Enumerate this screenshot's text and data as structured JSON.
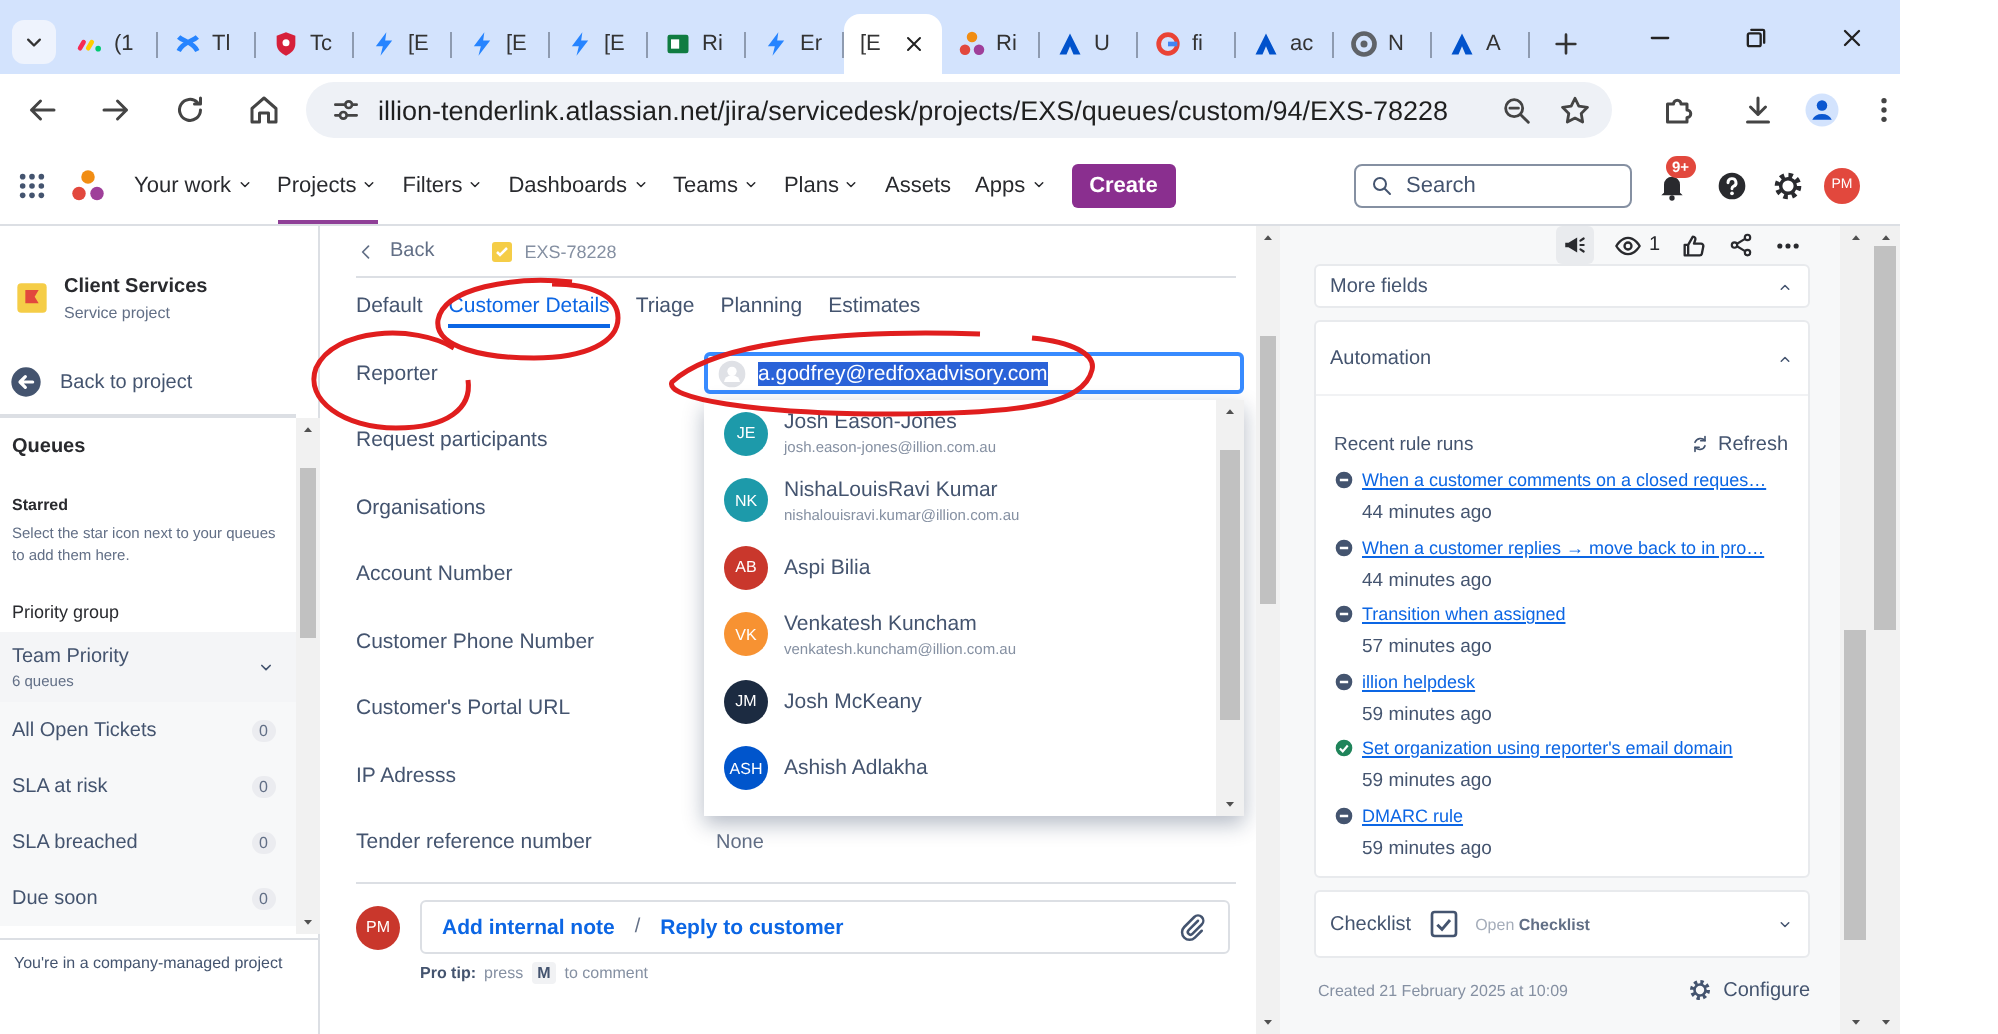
{
  "browser": {
    "tabs": [
      {
        "label": "(1",
        "kind": "bars",
        "selected": false
      },
      {
        "label": "Tl",
        "kind": "cross",
        "selected": false
      },
      {
        "label": "Tc",
        "kind": "shield",
        "selected": false
      },
      {
        "label": "[E",
        "kind": "bolt",
        "selected": false
      },
      {
        "label": "[E",
        "kind": "bolt",
        "selected": false
      },
      {
        "label": "[E",
        "kind": "bolt",
        "selected": false
      },
      {
        "label": "Ri",
        "kind": "sheet",
        "selected": false
      },
      {
        "label": "Er",
        "kind": "bolt",
        "selected": false
      },
      {
        "label": "[E",
        "selected": true
      },
      {
        "label": "Ri",
        "kind": "dots",
        "selected": false
      },
      {
        "label": "U",
        "kind": "peak",
        "selected": false
      },
      {
        "label": "fi",
        "kind": "ring",
        "selected": false
      },
      {
        "label": "ac",
        "kind": "peak",
        "selected": false
      },
      {
        "label": "N",
        "kind": "chrome",
        "selected": false
      },
      {
        "label": "A",
        "kind": "peak",
        "selected": false
      }
    ],
    "url": "illion-tenderlink.atlassian.net/jira/servicedesk/projects/EXS/queues/custom/94/EXS-78228"
  },
  "nav": {
    "items": [
      {
        "label": "Your work",
        "menu": true,
        "selected": false
      },
      {
        "label": "Projects",
        "menu": true,
        "selected": true
      },
      {
        "label": "Filters",
        "menu": true,
        "selected": false
      },
      {
        "label": "Dashboards",
        "menu": true,
        "selected": false
      },
      {
        "label": "Teams",
        "menu": true,
        "selected": false
      },
      {
        "label": "Plans",
        "menu": true,
        "selected": false
      },
      {
        "label": "Assets",
        "menu": false,
        "selected": false
      },
      {
        "label": "Apps",
        "menu": true,
        "selected": false
      }
    ],
    "create": "Create",
    "search": {
      "placeholder": "Search"
    },
    "notifications": "9+",
    "avatar": "PM"
  },
  "sidebar": {
    "project": {
      "name": "Client Services",
      "type": "Service project"
    },
    "back": "Back to project",
    "queues_heading": "Queues",
    "starred": {
      "heading": "Starred",
      "hint": "Select the star icon next to your queues to add them here."
    },
    "group": {
      "heading": "Priority group",
      "name": "Team Priority",
      "count": "6 queues"
    },
    "queues": [
      {
        "name": "All Open Tickets",
        "count": "0"
      },
      {
        "name": "SLA at risk",
        "count": "0"
      },
      {
        "name": "SLA breached",
        "count": "0"
      },
      {
        "name": "Due soon",
        "count": "0"
      }
    ],
    "footer": "You're in a company-managed project"
  },
  "issue": {
    "back": "Back",
    "key": "EXS-78228",
    "tabs": [
      {
        "label": "Default",
        "selected": false
      },
      {
        "label": "Customer Details",
        "selected": true
      },
      {
        "label": "Triage",
        "selected": false
      },
      {
        "label": "Planning",
        "selected": false
      },
      {
        "label": "Estimates",
        "selected": false
      }
    ],
    "fields": [
      {
        "label": "Reporter",
        "input": "a.godfrey@redfoxadvisory.com"
      },
      {
        "label": "Request participants"
      },
      {
        "label": "Organisations"
      },
      {
        "label": "Account Number"
      },
      {
        "label": "Customer Phone Number"
      },
      {
        "label": "Customer's Portal URL"
      },
      {
        "label": "IP Adresss"
      },
      {
        "label": "Tender reference number",
        "value": "None"
      }
    ],
    "suggestions": [
      {
        "initials": "JE",
        "name": "Josh Eason-Jones",
        "email": "josh.eason-jones@illion.com.au",
        "color": "#1d9aaa"
      },
      {
        "initials": "NK",
        "name": "NishaLouisRavi Kumar",
        "email": "nishalouisravi.kumar@illion.com.au",
        "color": "#1d9aaa"
      },
      {
        "initials": "AB",
        "name": "Aspi Bilia",
        "color": "#c9372c"
      },
      {
        "initials": "VK",
        "name": "Venkatesh Kuncham",
        "email": "venkatesh.kuncham@illion.com.au",
        "color": "#f79232"
      },
      {
        "initials": "JM",
        "name": "Josh McKeany",
        "color": "#1c2b41"
      },
      {
        "initials": "ASH",
        "name": "Ashish Adlakha",
        "color": "#0055cc"
      }
    ],
    "comment": {
      "avatar": "PM",
      "actions": [
        "Add internal note",
        "Reply to customer"
      ],
      "separator": "/"
    },
    "tip": {
      "label": "Pro tip:",
      "before": "press",
      "key": "M",
      "after": "to comment"
    }
  },
  "panel": {
    "watchers": "1",
    "more_fields": "More fields",
    "automation": {
      "title": "Automation",
      "recent": "Recent rule runs",
      "refresh": "Refresh",
      "rules": [
        {
          "name": "When a customer comments on a closed reques…",
          "time": "44 minutes ago",
          "kind": "skipped"
        },
        {
          "name": "When a customer replies → move back to in pro…",
          "time": "44 minutes ago",
          "kind": "skipped"
        },
        {
          "name": "Transition when assigned",
          "time": "57 minutes ago",
          "kind": "skipped"
        },
        {
          "name": "illion helpdesk",
          "time": "59 minutes ago",
          "kind": "skipped"
        },
        {
          "name": "Set organization using reporter's email domain",
          "time": "59 minutes ago",
          "kind": "success"
        },
        {
          "name": "DMARC rule",
          "time": "59 minutes ago",
          "kind": "skipped"
        }
      ]
    },
    "checklist": {
      "title": "Checklist",
      "action": "Open **Checklist**"
    },
    "created": "Created 21 February 2025 at 10:09",
    "configure": "Configure"
  }
}
